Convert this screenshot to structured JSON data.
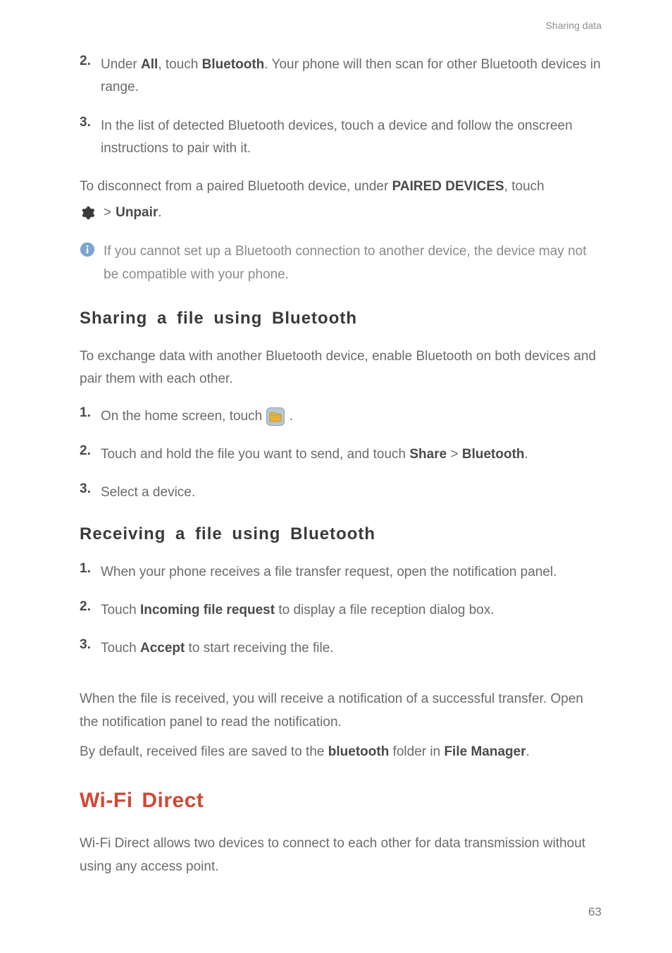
{
  "header": {
    "section": "Sharing data"
  },
  "continued": {
    "step2": {
      "num": "2.",
      "pre": "Under ",
      "b1": "All",
      "mid": ", touch ",
      "b2": "Bluetooth",
      "post": ". Your phone will then scan for other Bluetooth devices in range."
    },
    "step3": {
      "num": "3.",
      "text": "In the list of detected Bluetooth devices, touch a device and follow the onscreen instructions to pair with it."
    },
    "disconnect": {
      "pre": "To disconnect from a paired Bluetooth device, under ",
      "b": "PAIRED DEVICES",
      "post": ", touch"
    },
    "unpair": {
      "gt": ">",
      "b": "Unpair",
      "dot": "."
    },
    "note": "If you cannot set up a Bluetooth connection to another device, the device may not be compatible with your phone."
  },
  "sharing": {
    "title": "Sharing  a  file  using  Bluetooth",
    "intro": "To exchange data with another Bluetooth device, enable Bluetooth on both devices and pair them with each other.",
    "step1": {
      "num": "1.",
      "pre": "On the home screen, touch ",
      "post": " ."
    },
    "step2": {
      "num": "2.",
      "pre": "Touch and hold the file you want to send, and touch ",
      "b1": "Share",
      "gt": ">",
      "b2": "Bluetooth",
      "dot": "."
    },
    "step3": {
      "num": "3.",
      "text": "Select a device."
    }
  },
  "receiving": {
    "title": "Receiving  a  file  using  Bluetooth",
    "step1": {
      "num": "1.",
      "text": "When your phone receives a file transfer request, open the notification panel."
    },
    "step2": {
      "num": "2.",
      "pre": "Touch ",
      "b": "Incoming file request",
      "post": " to display a file reception dialog box."
    },
    "step3": {
      "num": "3.",
      "pre": "Touch ",
      "b": "Accept",
      "post": " to start receiving the file."
    },
    "para1": "When the file is received, you will receive a notification of a successful transfer. Open the notification panel to read the notification.",
    "para2": {
      "pre": "By default, received files are saved to the ",
      "b1": "bluetooth",
      "mid": " folder in ",
      "b2": "File Manager",
      "dot": "."
    }
  },
  "wifi": {
    "title": "Wi-Fi Direct",
    "para": "Wi-Fi Direct allows two devices to connect to each other for data transmission without using any access point."
  },
  "footer": {
    "page": "63"
  }
}
